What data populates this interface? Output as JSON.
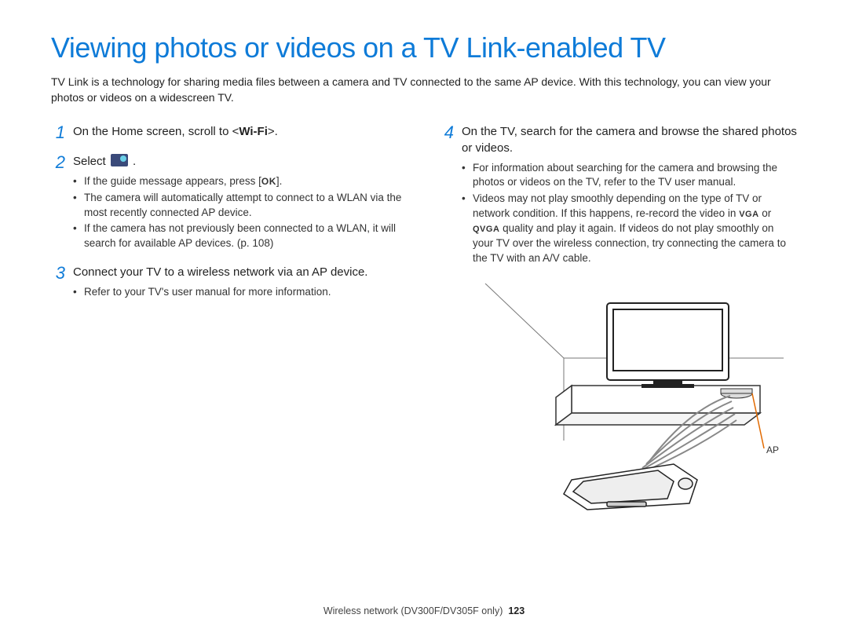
{
  "title": "Viewing photos or videos on a TV Link-enabled TV",
  "intro": "TV Link is a technology for sharing media files between a camera and TV connected to the same AP device. With this technology, you can view your photos or videos on a widescreen TV.",
  "left": {
    "step1": {
      "num": "1",
      "text_pre": "On the Home screen, scroll to <",
      "bold": "Wi-Fi",
      "text_post": ">."
    },
    "step2": {
      "num": "2",
      "text_pre": "Select ",
      "bullets_a": "If the guide message appears, press [",
      "bullets_a_ok": "OK",
      "bullets_a_post": "].",
      "bullets_b": "The camera will automatically attempt to connect to a WLAN via the most recently connected AP device.",
      "bullets_c": "If the camera has not previously been connected to a WLAN, it will search for available AP devices. (p. 108)"
    },
    "step3": {
      "num": "3",
      "text": "Connect your TV to a wireless network via an AP device.",
      "bullet": "Refer to your TV's user manual for more information."
    }
  },
  "right": {
    "step4": {
      "num": "4",
      "text": "On the TV, search for the camera and browse the shared photos or videos.",
      "bullet_a": "For information about searching for the camera and browsing the photos or videos on the TV, refer to the TV user manual.",
      "bullet_b_pre": "Videos may not play smoothly depending on the type of TV or network condition. If this happens, re-record the video in ",
      "bullet_b_res1": "VGA",
      "bullet_b_mid": " or ",
      "bullet_b_res2": "QVGA",
      "bullet_b_post": " quality and play it again. If videos do not play smoothly on your TV over the wireless connection, try connecting the camera to the TV with an A/V cable."
    },
    "ap_label": "AP"
  },
  "footer": {
    "section": "Wireless network (DV300F/DV305F only)",
    "page": "123"
  }
}
